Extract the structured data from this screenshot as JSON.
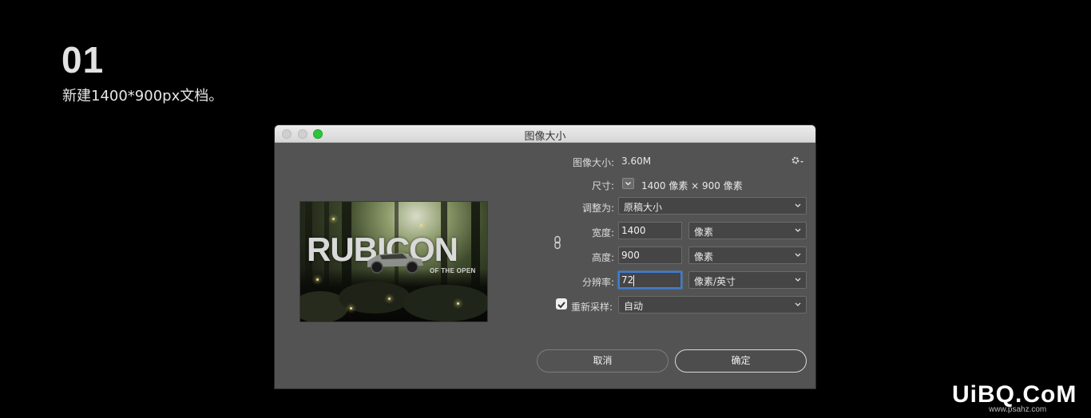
{
  "tutorial": {
    "step_number": "01",
    "step_description": "新建1400*900px文档。"
  },
  "dialog": {
    "title": "图像大小",
    "image_size_label": "图像大小:",
    "image_size_value": "3.60M",
    "dimensions_label": "尺寸:",
    "dimensions_value": "1400 像素  ×  900 像素",
    "fit_to_label": "调整为:",
    "fit_to_value": "原稿大小",
    "width_label": "宽度:",
    "width_value": "1400",
    "width_unit": "像素",
    "height_label": "高度:",
    "height_value": "900",
    "height_unit": "像素",
    "resolution_label": "分辨率:",
    "resolution_value": "72",
    "resolution_unit": "像素/英寸",
    "resample_label": "重新采样:",
    "resample_checked": true,
    "resample_value": "自动",
    "cancel_label": "取消",
    "ok_label": "确定"
  },
  "preview": {
    "title": "RUBICON",
    "subtitle": "OF THE OPEN"
  },
  "watermark": {
    "text": "UiBQ.CoM",
    "sub": "www.psahz.com"
  },
  "colors": {
    "dialog_bg": "#535353",
    "field_bg": "#454545",
    "focus_ring": "#3d7dd4",
    "maximize_button": "#2ec53b"
  }
}
